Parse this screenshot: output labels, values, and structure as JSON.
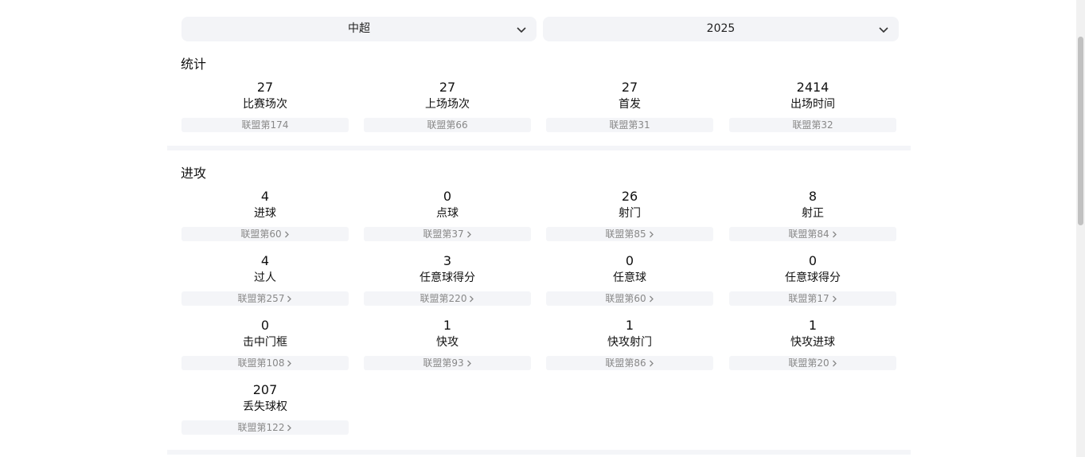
{
  "filters": {
    "league": "中超",
    "season": "2025"
  },
  "sections": {
    "stats": {
      "title": "统计",
      "items": [
        {
          "value": "27",
          "label": "比赛场次",
          "rank": "联盟第174"
        },
        {
          "value": "27",
          "label": "上场场次",
          "rank": "联盟第66"
        },
        {
          "value": "27",
          "label": "首发",
          "rank": "联盟第31"
        },
        {
          "value": "2414",
          "label": "出场时间",
          "rank": "联盟第32"
        }
      ]
    },
    "attack": {
      "title": "进攻",
      "items": [
        {
          "value": "4",
          "label": "进球",
          "rank": "联盟第60"
        },
        {
          "value": "0",
          "label": "点球",
          "rank": "联盟第37"
        },
        {
          "value": "26",
          "label": "射门",
          "rank": "联盟第85"
        },
        {
          "value": "8",
          "label": "射正",
          "rank": "联盟第84"
        },
        {
          "value": "4",
          "label": "过人",
          "rank": "联盟第257"
        },
        {
          "value": "3",
          "label": "任意球得分",
          "rank": "联盟第220"
        },
        {
          "value": "0",
          "label": "任意球",
          "rank": "联盟第60"
        },
        {
          "value": "0",
          "label": "任意球得分",
          "rank": "联盟第17"
        },
        {
          "value": "0",
          "label": "击中门框",
          "rank": "联盟第108"
        },
        {
          "value": "1",
          "label": "快攻",
          "rank": "联盟第93"
        },
        {
          "value": "1",
          "label": "快攻射门",
          "rank": "联盟第86"
        },
        {
          "value": "1",
          "label": "快攻进球",
          "rank": "联盟第20"
        },
        {
          "value": "207",
          "label": "丢失球权",
          "rank": "联盟第122"
        }
      ]
    }
  }
}
